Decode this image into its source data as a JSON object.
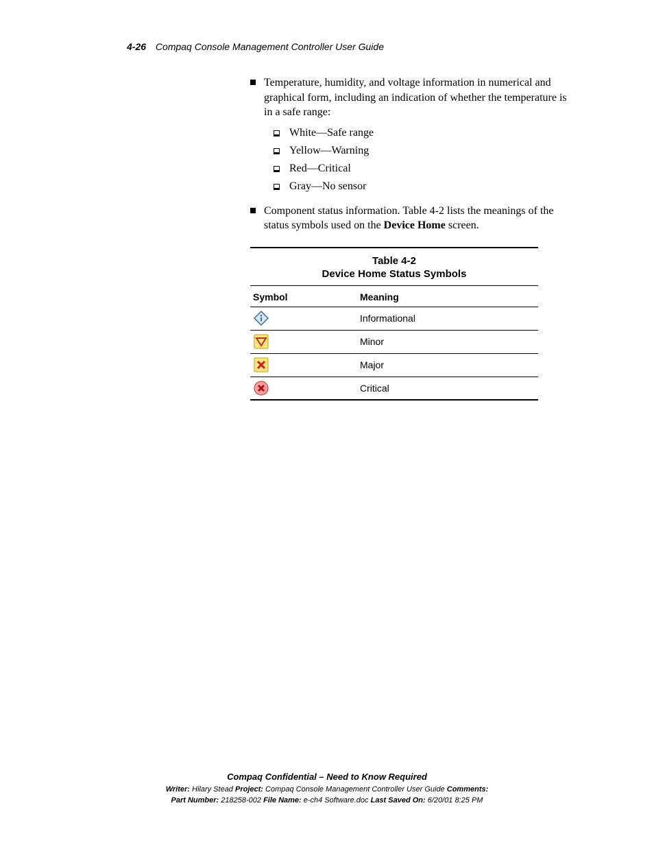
{
  "header": {
    "page_num": "4-26",
    "doc_title": "Compaq Console Management Controller User Guide"
  },
  "content": {
    "bullet1": {
      "text": "Temperature, humidity, and voltage information in numerical and graphical form, including an indication of whether the temperature is in a safe range:",
      "sub": [
        "White—Safe range",
        "Yellow—Warning",
        "Red—Critical",
        "Gray—No sensor"
      ]
    },
    "bullet2": {
      "prefix": "Component status information. Table 4-2 lists the meanings of the status symbols used on the ",
      "bold": "Device Home",
      "suffix": " screen."
    }
  },
  "table": {
    "number": "Table 4-2",
    "title": "Device Home Status Symbols",
    "header": {
      "symbol": "Symbol",
      "meaning": "Meaning"
    },
    "rows": [
      {
        "meaning": "Informational"
      },
      {
        "meaning": "Minor"
      },
      {
        "meaning": "Major"
      },
      {
        "meaning": "Critical"
      }
    ]
  },
  "footer": {
    "confidential": "Compaq Confidential – Need to Know Required",
    "writer_label": "Writer:",
    "writer": " Hilary Stead  ",
    "project_label": "Project:",
    "project": " Compaq Console Management Controller User Guide  ",
    "comments_label": "Comments:",
    "partnum_label": "Part Number:",
    "partnum": " 218258-002  ",
    "filename_label": "File Name:",
    "filename": " e-ch4 Software.doc  ",
    "lastsaved_label": "Last Saved On:",
    "lastsaved": " 6/20/01 8:25 PM"
  }
}
